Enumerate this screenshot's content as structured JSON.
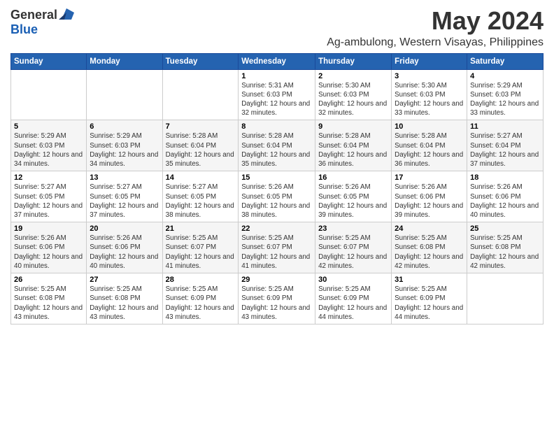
{
  "logo": {
    "general": "General",
    "blue": "Blue"
  },
  "header": {
    "month": "May 2024",
    "location": "Ag-ambulong, Western Visayas, Philippines"
  },
  "weekdays": [
    "Sunday",
    "Monday",
    "Tuesday",
    "Wednesday",
    "Thursday",
    "Friday",
    "Saturday"
  ],
  "weeks": [
    [
      {
        "day": "",
        "sunrise": "",
        "sunset": "",
        "daylight": ""
      },
      {
        "day": "",
        "sunrise": "",
        "sunset": "",
        "daylight": ""
      },
      {
        "day": "",
        "sunrise": "",
        "sunset": "",
        "daylight": ""
      },
      {
        "day": "1",
        "sunrise": "Sunrise: 5:31 AM",
        "sunset": "Sunset: 6:03 PM",
        "daylight": "Daylight: 12 hours and 32 minutes."
      },
      {
        "day": "2",
        "sunrise": "Sunrise: 5:30 AM",
        "sunset": "Sunset: 6:03 PM",
        "daylight": "Daylight: 12 hours and 32 minutes."
      },
      {
        "day": "3",
        "sunrise": "Sunrise: 5:30 AM",
        "sunset": "Sunset: 6:03 PM",
        "daylight": "Daylight: 12 hours and 33 minutes."
      },
      {
        "day": "4",
        "sunrise": "Sunrise: 5:29 AM",
        "sunset": "Sunset: 6:03 PM",
        "daylight": "Daylight: 12 hours and 33 minutes."
      }
    ],
    [
      {
        "day": "5",
        "sunrise": "Sunrise: 5:29 AM",
        "sunset": "Sunset: 6:03 PM",
        "daylight": "Daylight: 12 hours and 34 minutes."
      },
      {
        "day": "6",
        "sunrise": "Sunrise: 5:29 AM",
        "sunset": "Sunset: 6:03 PM",
        "daylight": "Daylight: 12 hours and 34 minutes."
      },
      {
        "day": "7",
        "sunrise": "Sunrise: 5:28 AM",
        "sunset": "Sunset: 6:04 PM",
        "daylight": "Daylight: 12 hours and 35 minutes."
      },
      {
        "day": "8",
        "sunrise": "Sunrise: 5:28 AM",
        "sunset": "Sunset: 6:04 PM",
        "daylight": "Daylight: 12 hours and 35 minutes."
      },
      {
        "day": "9",
        "sunrise": "Sunrise: 5:28 AM",
        "sunset": "Sunset: 6:04 PM",
        "daylight": "Daylight: 12 hours and 36 minutes."
      },
      {
        "day": "10",
        "sunrise": "Sunrise: 5:28 AM",
        "sunset": "Sunset: 6:04 PM",
        "daylight": "Daylight: 12 hours and 36 minutes."
      },
      {
        "day": "11",
        "sunrise": "Sunrise: 5:27 AM",
        "sunset": "Sunset: 6:04 PM",
        "daylight": "Daylight: 12 hours and 37 minutes."
      }
    ],
    [
      {
        "day": "12",
        "sunrise": "Sunrise: 5:27 AM",
        "sunset": "Sunset: 6:05 PM",
        "daylight": "Daylight: 12 hours and 37 minutes."
      },
      {
        "day": "13",
        "sunrise": "Sunrise: 5:27 AM",
        "sunset": "Sunset: 6:05 PM",
        "daylight": "Daylight: 12 hours and 37 minutes."
      },
      {
        "day": "14",
        "sunrise": "Sunrise: 5:27 AM",
        "sunset": "Sunset: 6:05 PM",
        "daylight": "Daylight: 12 hours and 38 minutes."
      },
      {
        "day": "15",
        "sunrise": "Sunrise: 5:26 AM",
        "sunset": "Sunset: 6:05 PM",
        "daylight": "Daylight: 12 hours and 38 minutes."
      },
      {
        "day": "16",
        "sunrise": "Sunrise: 5:26 AM",
        "sunset": "Sunset: 6:05 PM",
        "daylight": "Daylight: 12 hours and 39 minutes."
      },
      {
        "day": "17",
        "sunrise": "Sunrise: 5:26 AM",
        "sunset": "Sunset: 6:06 PM",
        "daylight": "Daylight: 12 hours and 39 minutes."
      },
      {
        "day": "18",
        "sunrise": "Sunrise: 5:26 AM",
        "sunset": "Sunset: 6:06 PM",
        "daylight": "Daylight: 12 hours and 40 minutes."
      }
    ],
    [
      {
        "day": "19",
        "sunrise": "Sunrise: 5:26 AM",
        "sunset": "Sunset: 6:06 PM",
        "daylight": "Daylight: 12 hours and 40 minutes."
      },
      {
        "day": "20",
        "sunrise": "Sunrise: 5:26 AM",
        "sunset": "Sunset: 6:06 PM",
        "daylight": "Daylight: 12 hours and 40 minutes."
      },
      {
        "day": "21",
        "sunrise": "Sunrise: 5:25 AM",
        "sunset": "Sunset: 6:07 PM",
        "daylight": "Daylight: 12 hours and 41 minutes."
      },
      {
        "day": "22",
        "sunrise": "Sunrise: 5:25 AM",
        "sunset": "Sunset: 6:07 PM",
        "daylight": "Daylight: 12 hours and 41 minutes."
      },
      {
        "day": "23",
        "sunrise": "Sunrise: 5:25 AM",
        "sunset": "Sunset: 6:07 PM",
        "daylight": "Daylight: 12 hours and 42 minutes."
      },
      {
        "day": "24",
        "sunrise": "Sunrise: 5:25 AM",
        "sunset": "Sunset: 6:08 PM",
        "daylight": "Daylight: 12 hours and 42 minutes."
      },
      {
        "day": "25",
        "sunrise": "Sunrise: 5:25 AM",
        "sunset": "Sunset: 6:08 PM",
        "daylight": "Daylight: 12 hours and 42 minutes."
      }
    ],
    [
      {
        "day": "26",
        "sunrise": "Sunrise: 5:25 AM",
        "sunset": "Sunset: 6:08 PM",
        "daylight": "Daylight: 12 hours and 43 minutes."
      },
      {
        "day": "27",
        "sunrise": "Sunrise: 5:25 AM",
        "sunset": "Sunset: 6:08 PM",
        "daylight": "Daylight: 12 hours and 43 minutes."
      },
      {
        "day": "28",
        "sunrise": "Sunrise: 5:25 AM",
        "sunset": "Sunset: 6:09 PM",
        "daylight": "Daylight: 12 hours and 43 minutes."
      },
      {
        "day": "29",
        "sunrise": "Sunrise: 5:25 AM",
        "sunset": "Sunset: 6:09 PM",
        "daylight": "Daylight: 12 hours and 43 minutes."
      },
      {
        "day": "30",
        "sunrise": "Sunrise: 5:25 AM",
        "sunset": "Sunset: 6:09 PM",
        "daylight": "Daylight: 12 hours and 44 minutes."
      },
      {
        "day": "31",
        "sunrise": "Sunrise: 5:25 AM",
        "sunset": "Sunset: 6:09 PM",
        "daylight": "Daylight: 12 hours and 44 minutes."
      },
      {
        "day": "",
        "sunrise": "",
        "sunset": "",
        "daylight": ""
      }
    ]
  ]
}
